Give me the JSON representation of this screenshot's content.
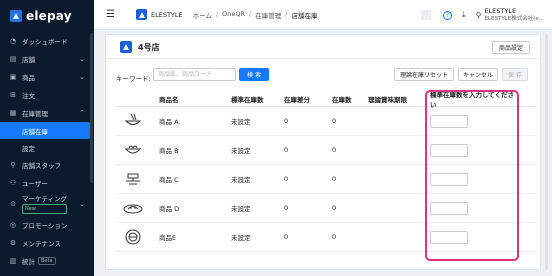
{
  "brand": {
    "name": "elepay"
  },
  "sidebar": {
    "items": [
      {
        "icon": "dashboard-icon",
        "label": "ダッシュボード",
        "chevron": false
      },
      {
        "icon": "store-icon",
        "label": "店舗",
        "chevron": true
      },
      {
        "icon": "product-icon",
        "label": "商品",
        "chevron": true
      },
      {
        "icon": "order-icon",
        "label": "注文",
        "chevron": false
      },
      {
        "icon": "inventory-icon",
        "label": "在庫管理",
        "chevron": true
      }
    ],
    "subitems": [
      {
        "label": "店舗在庫",
        "active": true
      },
      {
        "label": "設定",
        "active": false
      }
    ],
    "items2": [
      {
        "icon": "staff-icon",
        "label": "店舗スタッフ",
        "chevron": false
      },
      {
        "icon": "user-icon",
        "label": "ユーザー",
        "chevron": false
      }
    ],
    "marketing": {
      "label": "マーケティング",
      "badge": "New"
    },
    "items3": [
      {
        "icon": "promotion-icon",
        "label": "プロモーション"
      },
      {
        "icon": "maintenance-icon",
        "label": "メンテナンス"
      }
    ],
    "stats": {
      "label": "統計",
      "badge": "Beta"
    }
  },
  "topbar": {
    "store_name": "ELESTYLE",
    "breadcrumb": [
      "ホーム",
      "OneQR",
      "在庫管理",
      "店舗在庫"
    ],
    "user_name": "ELESTYLE",
    "user_sub": "ELESTYLE株式会社(e..."
  },
  "card": {
    "shop_name": "4号店",
    "settings_button": "商品設定",
    "keyword_label": "キーワード:",
    "keyword_placeholder": "商品名、商品コード",
    "search_button": "検 索",
    "reset_button": "理論在庫リセット",
    "cancel_button": "キャンセル",
    "save_button": "保 存"
  },
  "table": {
    "headers": {
      "name": "商品名",
      "std": "標準在庫数",
      "diff": "在庫差分",
      "stock": "在庫数",
      "exp": "理論賞味期限",
      "input": "標準在庫数を入力してください"
    },
    "rows": [
      {
        "name": "商品 A",
        "std": "未設定",
        "diff": "0",
        "stock": "0",
        "icon": "noodle-bowl-icon"
      },
      {
        "name": "商品 B",
        "std": "未設定",
        "diff": "0",
        "stock": "0",
        "icon": "ramen-icon"
      },
      {
        "name": "商品 C",
        "std": "未設定",
        "diff": "0",
        "stock": "0",
        "icon": "rice-bowl-icon"
      },
      {
        "name": "商品 D",
        "std": "未設定",
        "diff": "0",
        "stock": "0",
        "icon": "dish-icon"
      },
      {
        "name": "商品E",
        "std": "未設定",
        "diff": "0",
        "stock": "0",
        "icon": "bento-icon"
      }
    ]
  },
  "colors": {
    "sidebar_bg": "#0c1a2e",
    "accent": "#1677ff",
    "highlight": "#e0337a"
  }
}
